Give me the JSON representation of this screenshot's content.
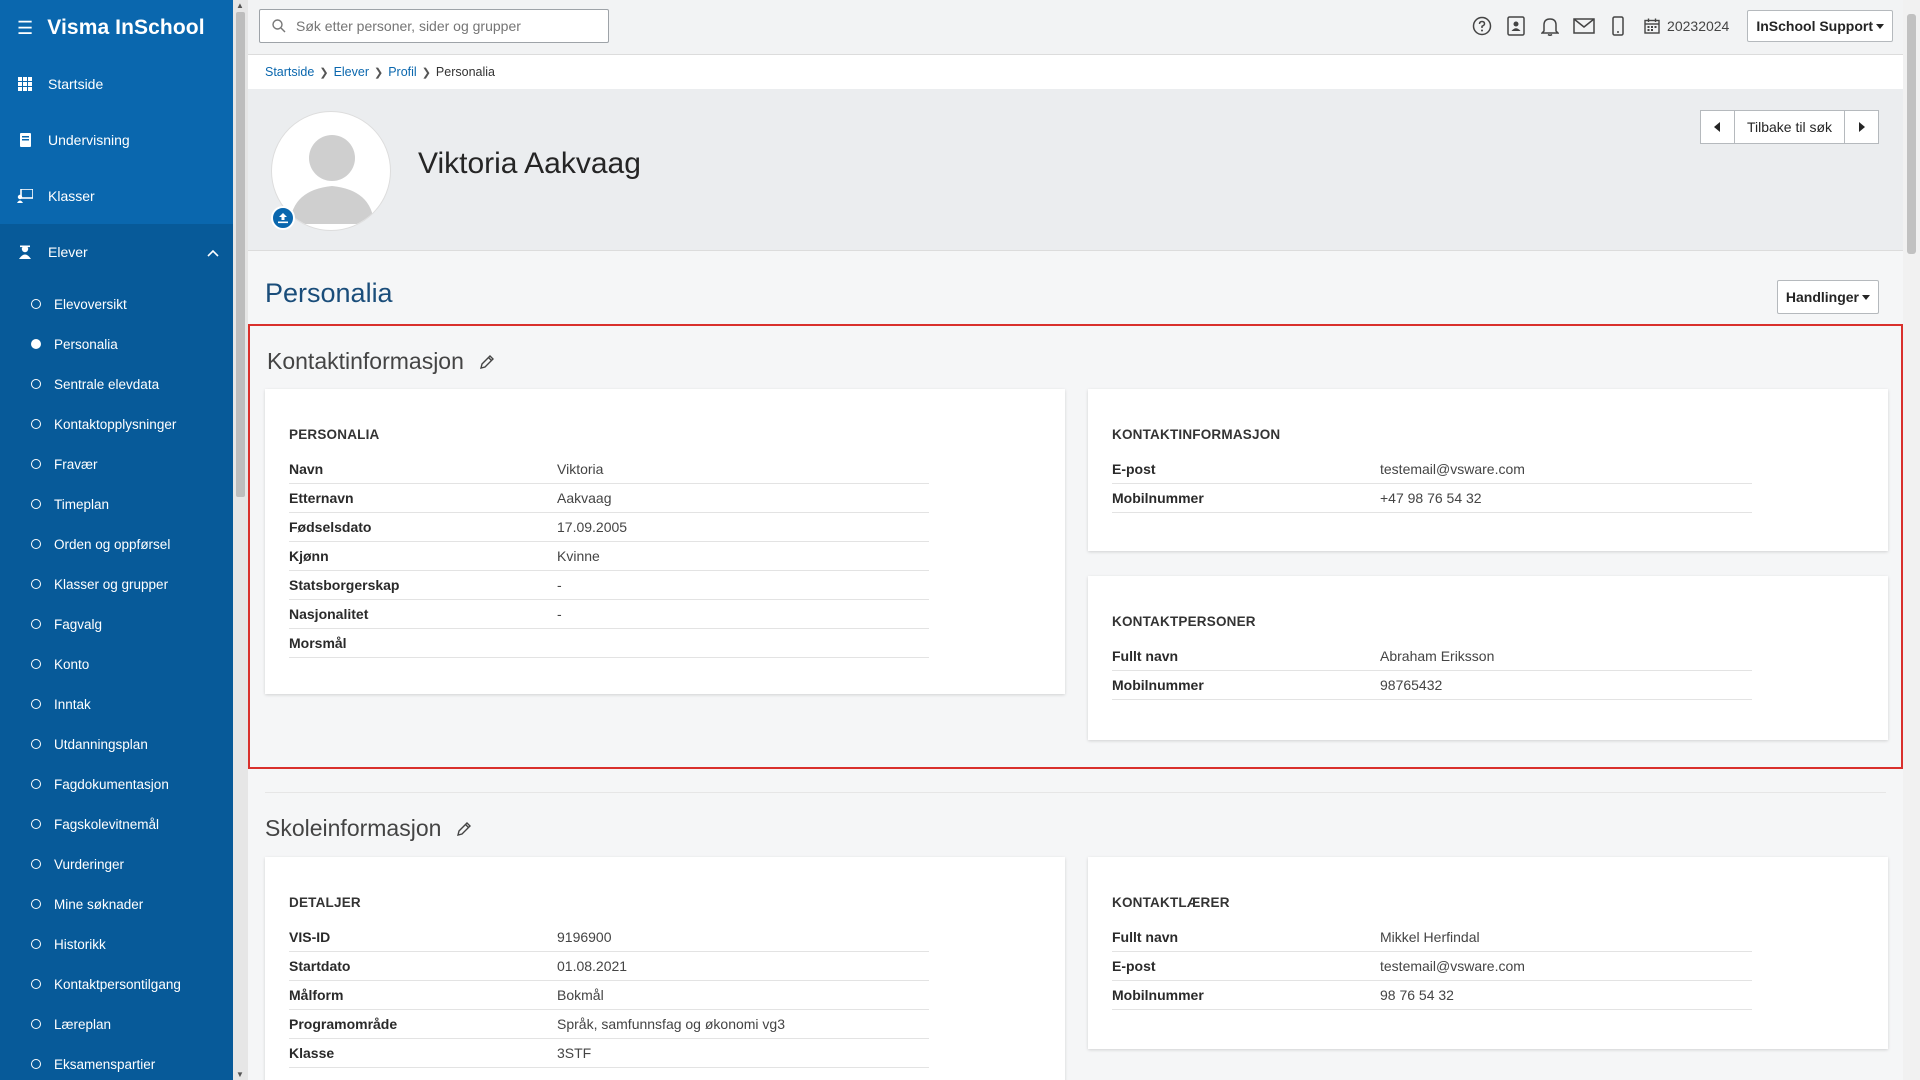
{
  "app": {
    "title": "Visma InSchool"
  },
  "sidebar": {
    "items": [
      {
        "label": "Startside"
      },
      {
        "label": "Undervisning"
      },
      {
        "label": "Klasser"
      },
      {
        "label": "Elever"
      }
    ],
    "sub_items": [
      {
        "label": "Elevoversikt"
      },
      {
        "label": "Personalia"
      },
      {
        "label": "Sentrale elevdata"
      },
      {
        "label": "Kontaktopplysninger"
      },
      {
        "label": "Fravær"
      },
      {
        "label": "Timeplan"
      },
      {
        "label": "Orden og oppførsel"
      },
      {
        "label": "Klasser og grupper"
      },
      {
        "label": "Fagvalg"
      },
      {
        "label": "Konto"
      },
      {
        "label": "Inntak"
      },
      {
        "label": "Utdanningsplan"
      },
      {
        "label": "Fagdokumentasjon"
      },
      {
        "label": "Fagskolevitnemål"
      },
      {
        "label": "Vurderinger"
      },
      {
        "label": "Mine søknader"
      },
      {
        "label": "Historikk"
      },
      {
        "label": "Kontaktpersontilgang"
      },
      {
        "label": "Læreplan"
      },
      {
        "label": "Eksamenspartier"
      }
    ],
    "selected_sub": "Personalia"
  },
  "topbar": {
    "search_placeholder": "Søk etter personer, sider og grupper",
    "school_year": "20232024",
    "user_menu": "InSchool Support"
  },
  "breadcrumb": {
    "items": [
      "Startside",
      "Elever",
      "Profil"
    ],
    "current": "Personalia"
  },
  "profile": {
    "name": "Viktoria Aakvaag",
    "back_label": "Tilbake til søk"
  },
  "page": {
    "title": "Personalia",
    "actions_label": "Handlinger"
  },
  "contact_section": {
    "heading": "Kontaktinformasjon",
    "personalia_card": {
      "title": "PERSONALIA",
      "rows": [
        {
          "k": "Navn",
          "v": "Viktoria"
        },
        {
          "k": "Etternavn",
          "v": "Aakvaag"
        },
        {
          "k": "Fødselsdato",
          "v": "17.09.2005"
        },
        {
          "k": "Kjønn",
          "v": "Kvinne"
        },
        {
          "k": "Statsborgerskap",
          "v": "-"
        },
        {
          "k": "Nasjonalitet",
          "v": "-"
        },
        {
          "k": "Morsmål",
          "v": ""
        }
      ]
    },
    "contact_card": {
      "title": "KONTAKTINFORMASJON",
      "rows": [
        {
          "k": "E-post",
          "v": "testemail@vsware.com"
        },
        {
          "k": "Mobilnummer",
          "v": "+47 98 76 54 32"
        }
      ]
    },
    "contact_persons_card": {
      "title": "KONTAKTPERSONER",
      "rows": [
        {
          "k": "Fullt navn",
          "v": "Abraham Eriksson"
        },
        {
          "k": "Mobilnummer",
          "v": "98765432"
        }
      ]
    }
  },
  "school_section": {
    "heading": "Skoleinformasjon",
    "details_card": {
      "title": "DETALJER",
      "rows": [
        {
          "k": "VIS-ID",
          "v": "9196900"
        },
        {
          "k": "Startdato",
          "v": "01.08.2021"
        },
        {
          "k": "Målform",
          "v": "Bokmål"
        },
        {
          "k": "Programområde",
          "v": "Språk, samfunnsfag og økonomi vg3"
        },
        {
          "k": "Klasse",
          "v": "3STF"
        }
      ]
    },
    "teacher_card": {
      "title": "KONTAKTLÆRER",
      "rows": [
        {
          "k": "Fullt navn",
          "v": "Mikkel Herfindal"
        },
        {
          "k": "E-post",
          "v": "testemail@vsware.com"
        },
        {
          "k": "Mobilnummer",
          "v": "98 76 54 32"
        }
      ]
    }
  },
  "colors": {
    "sidebar_bg": "#0a67ae",
    "highlight_border": "#d9302c",
    "link": "#0a67ae"
  }
}
